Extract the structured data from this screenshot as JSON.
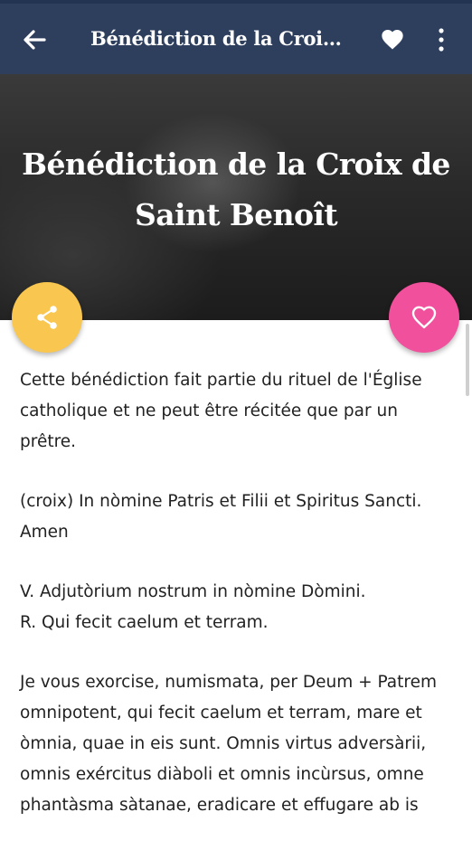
{
  "app_bar": {
    "title": "Bénédiction de la Croix de ...",
    "back_icon": "arrow-left-icon",
    "favorite_icon": "heart-filled-icon",
    "menu_icon": "more-vertical-icon"
  },
  "hero": {
    "title": "Bénédiction de la Croix de Saint Benoît"
  },
  "fabs": {
    "share_icon": "share-icon",
    "share_color": "#f9c74f",
    "like_icon": "heart-outline-icon",
    "like_color": "#f0509c"
  },
  "colors": {
    "app_bar": "#2e3f5e",
    "text": "#222222"
  },
  "content": {
    "paragraphs": [
      "Cette bénédiction fait partie du rituel de l'Église catholique et ne peut être récitée que par un prêtre.",
      "(croix) In nòmine Patris et Filii et Spiritus Sancti. Amen",
      "V. Adjutòrium nostrum in nòmine Dòmini.\nR. Qui fecit caelum et terram.",
      "Je vous exorcise, numismata, per Deum + Patrem omnipotent, qui fecit caelum et terram, mare et òmnia, quae in eis sunt. Omnis virtus adversàrii, omnis exércitus diàboli et omnis incùrsus, omne phantàsma sàtanae, eradicare et effugare ab is"
    ]
  }
}
